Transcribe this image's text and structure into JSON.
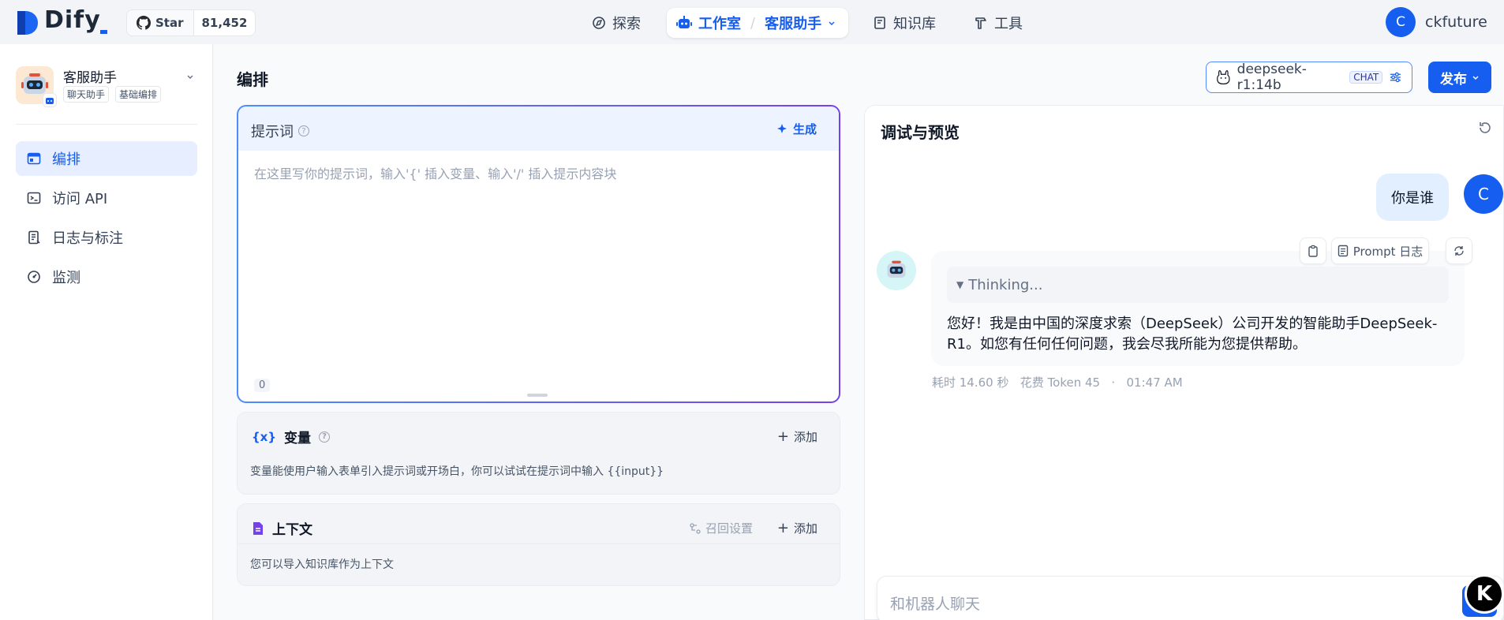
{
  "brand": {
    "name": "Dify"
  },
  "github": {
    "star_label": "Star",
    "count": "81,452"
  },
  "nav": {
    "explore": "探索",
    "studio": "工作室",
    "app": "客服助手",
    "knowledge": "知识库",
    "tools": "工具"
  },
  "user": {
    "initial": "C",
    "name": "ckfuture"
  },
  "sidebar": {
    "app_name": "客服助手",
    "tags": [
      "聊天助手",
      "基础编排"
    ],
    "items": [
      {
        "label": "编排",
        "icon": "layout-icon",
        "active": true
      },
      {
        "label": "访问 API",
        "icon": "terminal-icon",
        "active": false
      },
      {
        "label": "日志与标注",
        "icon": "file-list-icon",
        "active": false
      },
      {
        "label": "监测",
        "icon": "gauge-icon",
        "active": false
      }
    ]
  },
  "main": {
    "title": "编排",
    "model": {
      "name": "deepseek-r1:14b",
      "badge": "CHAT"
    },
    "publish_label": "发布"
  },
  "prompt": {
    "label": "提示词",
    "generate_label": "生成",
    "placeholder": "在这里写你的提示词，输入'{' 插入变量、输入'/' 插入提示内容块",
    "count": "0"
  },
  "variables": {
    "icon_text": "{x}",
    "title": "变量",
    "add_label": "添加",
    "desc": "变量能使用户输入表单引入提示词或开场白，你可以试试在提示词中输入 {{input}}"
  },
  "context": {
    "title": "上下文",
    "recall_label": "召回设置",
    "add_label": "添加",
    "desc": "您可以导入知识库作为上下文"
  },
  "debug": {
    "title": "调试与预览",
    "user_message": "你是谁",
    "prompt_log_label": "Prompt 日志",
    "thinking_label": "Thinking...",
    "answer": "您好！我是由中国的深度求索（DeepSeek）公司开发的智能助手DeepSeek-R1。如您有任何任何问题，我会尽我所能为您提供帮助。",
    "meta_time": "耗时 14.60 秒",
    "meta_tokens": "花费 Token 45",
    "meta_dot": "·",
    "meta_clock": "01:47 AM",
    "input_placeholder": "和机器人聊天"
  },
  "colors": {
    "accent": "#155eef",
    "gradient_start": "#4b8cff",
    "gradient_end": "#7442e8"
  }
}
